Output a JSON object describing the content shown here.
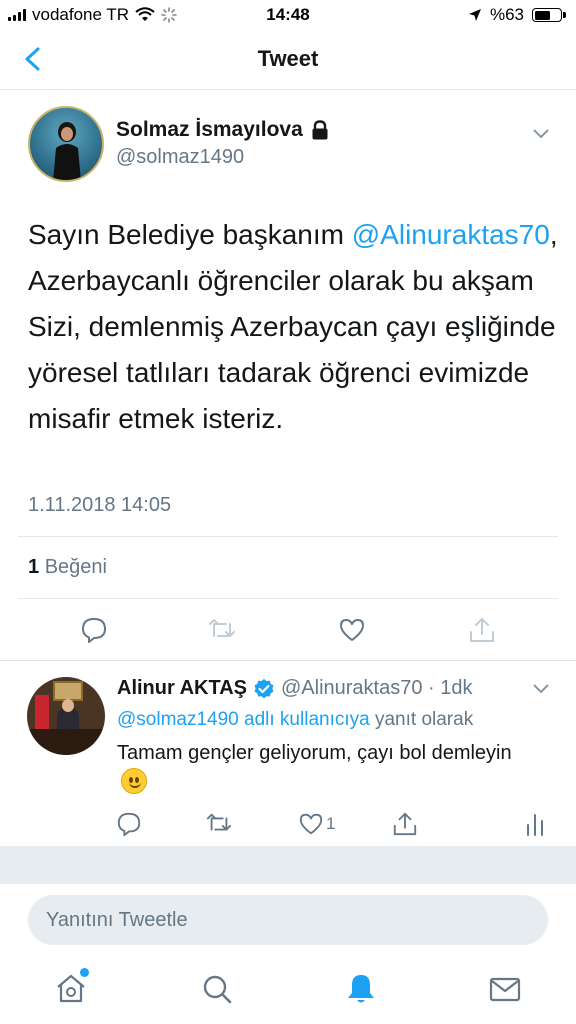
{
  "status_bar": {
    "carrier": "vodafone TR",
    "time": "14:48",
    "battery": "%63"
  },
  "nav": {
    "title": "Tweet",
    "back_icon": "chevron-left-icon"
  },
  "main_tweet": {
    "author_name": "Solmaz İsmayılova",
    "author_handle": "@solmaz1490",
    "locked": true,
    "text_part1": "Sayın Belediye başkanım ",
    "mention": "@Alinuraktas70",
    "text_part2": ", Azerbaycanlı öğrenciler olarak bu akşam Sizi, demlenmiş  Azerbaycan çayı eşliğinde yöresel tatlıları tadarak  öğrenci evimizde misafir etmek isteriz.",
    "date": "1.11.2018 14:05",
    "likes_count": "1",
    "likes_label": "Beğeni"
  },
  "reply_tweet": {
    "author_name": "Alinur AKTAŞ",
    "verified": true,
    "meta": "@Alinuraktas70 · 1dk",
    "reply_to_mention": "@solmaz1490 adlı kullanıcıya",
    "reply_to_suffix": " yanıt olarak",
    "text": "Tamam gençler geliyorum, çayı bol demleyin",
    "like_count": "1"
  },
  "composer": {
    "placeholder": "Yanıtını Tweetle"
  },
  "tabbar": {
    "items": [
      "home-icon",
      "search-icon",
      "notifications-icon",
      "messages-icon"
    ],
    "active": "notifications-icon"
  },
  "colors": {
    "accent": "#1da1f2",
    "secondary_text": "#657786",
    "divider": "#e1e8ed",
    "band": "#e6ecf0"
  }
}
